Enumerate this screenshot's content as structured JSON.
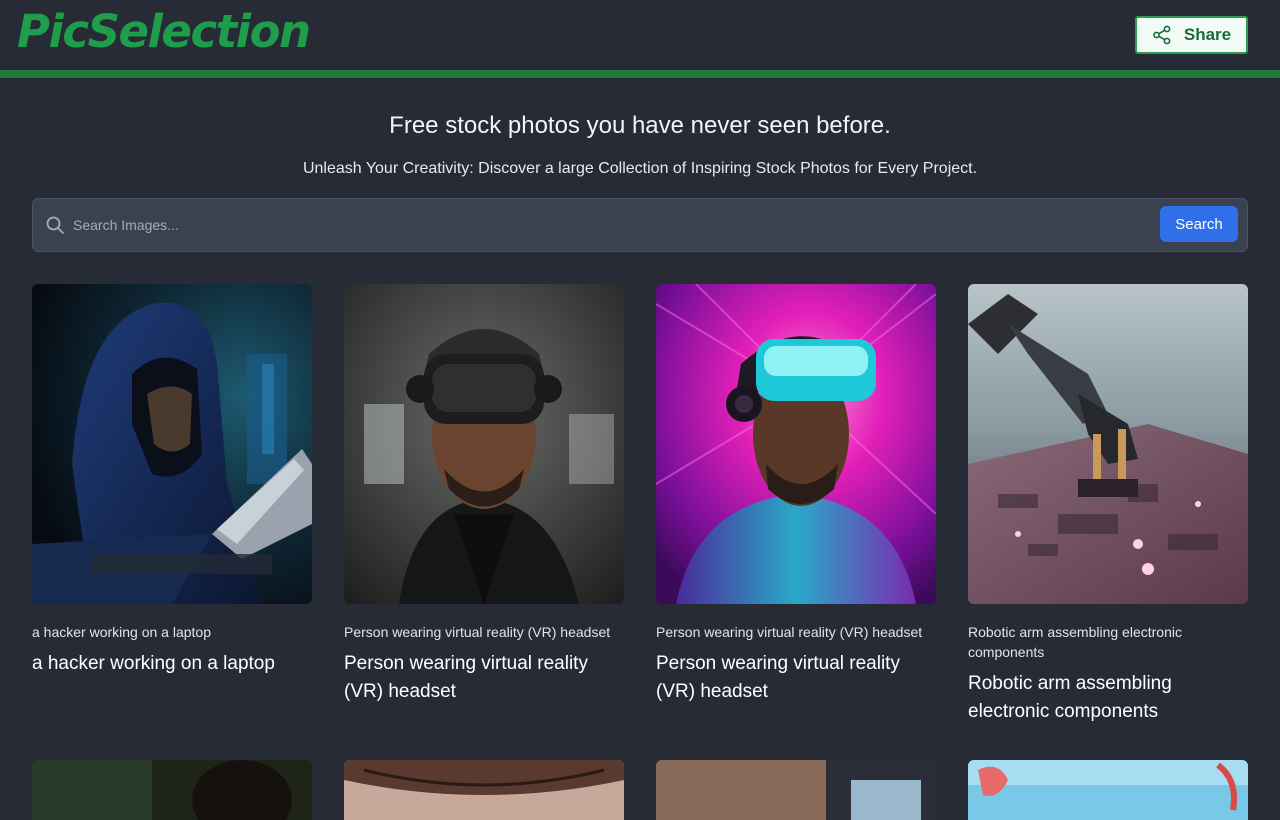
{
  "brand": {
    "logo": "PicSelection",
    "accent": "#1e9e4a"
  },
  "header": {
    "share_label": "Share",
    "share_icon": "share-icon"
  },
  "hero": {
    "title": "Free stock photos you have never seen before.",
    "subtitle": "Unleash Your Creativity: Discover a large Collection of Inspiring Stock Photos for Every Project."
  },
  "search": {
    "placeholder": "Search Images...",
    "value": "",
    "button_label": "Search",
    "icon": "search-icon",
    "button_color": "#2f6fe8"
  },
  "cards": [
    {
      "caption": "a hacker working on a laptop",
      "title": "a hacker working on a laptop",
      "image": "hacker-laptop-image"
    },
    {
      "caption": "Person wearing virtual reality (VR) headset",
      "title": "Person wearing virtual reality (VR) headset",
      "image": "vr-headset-image"
    },
    {
      "caption": "Person wearing virtual reality (VR) headset",
      "title": "Person wearing virtual reality (VR) headset",
      "image": "vr-headset-neon-image"
    },
    {
      "caption": "Robotic arm assembling electronic components",
      "title": "Robotic arm assembling electronic components",
      "image": "robotic-arm-image"
    }
  ]
}
